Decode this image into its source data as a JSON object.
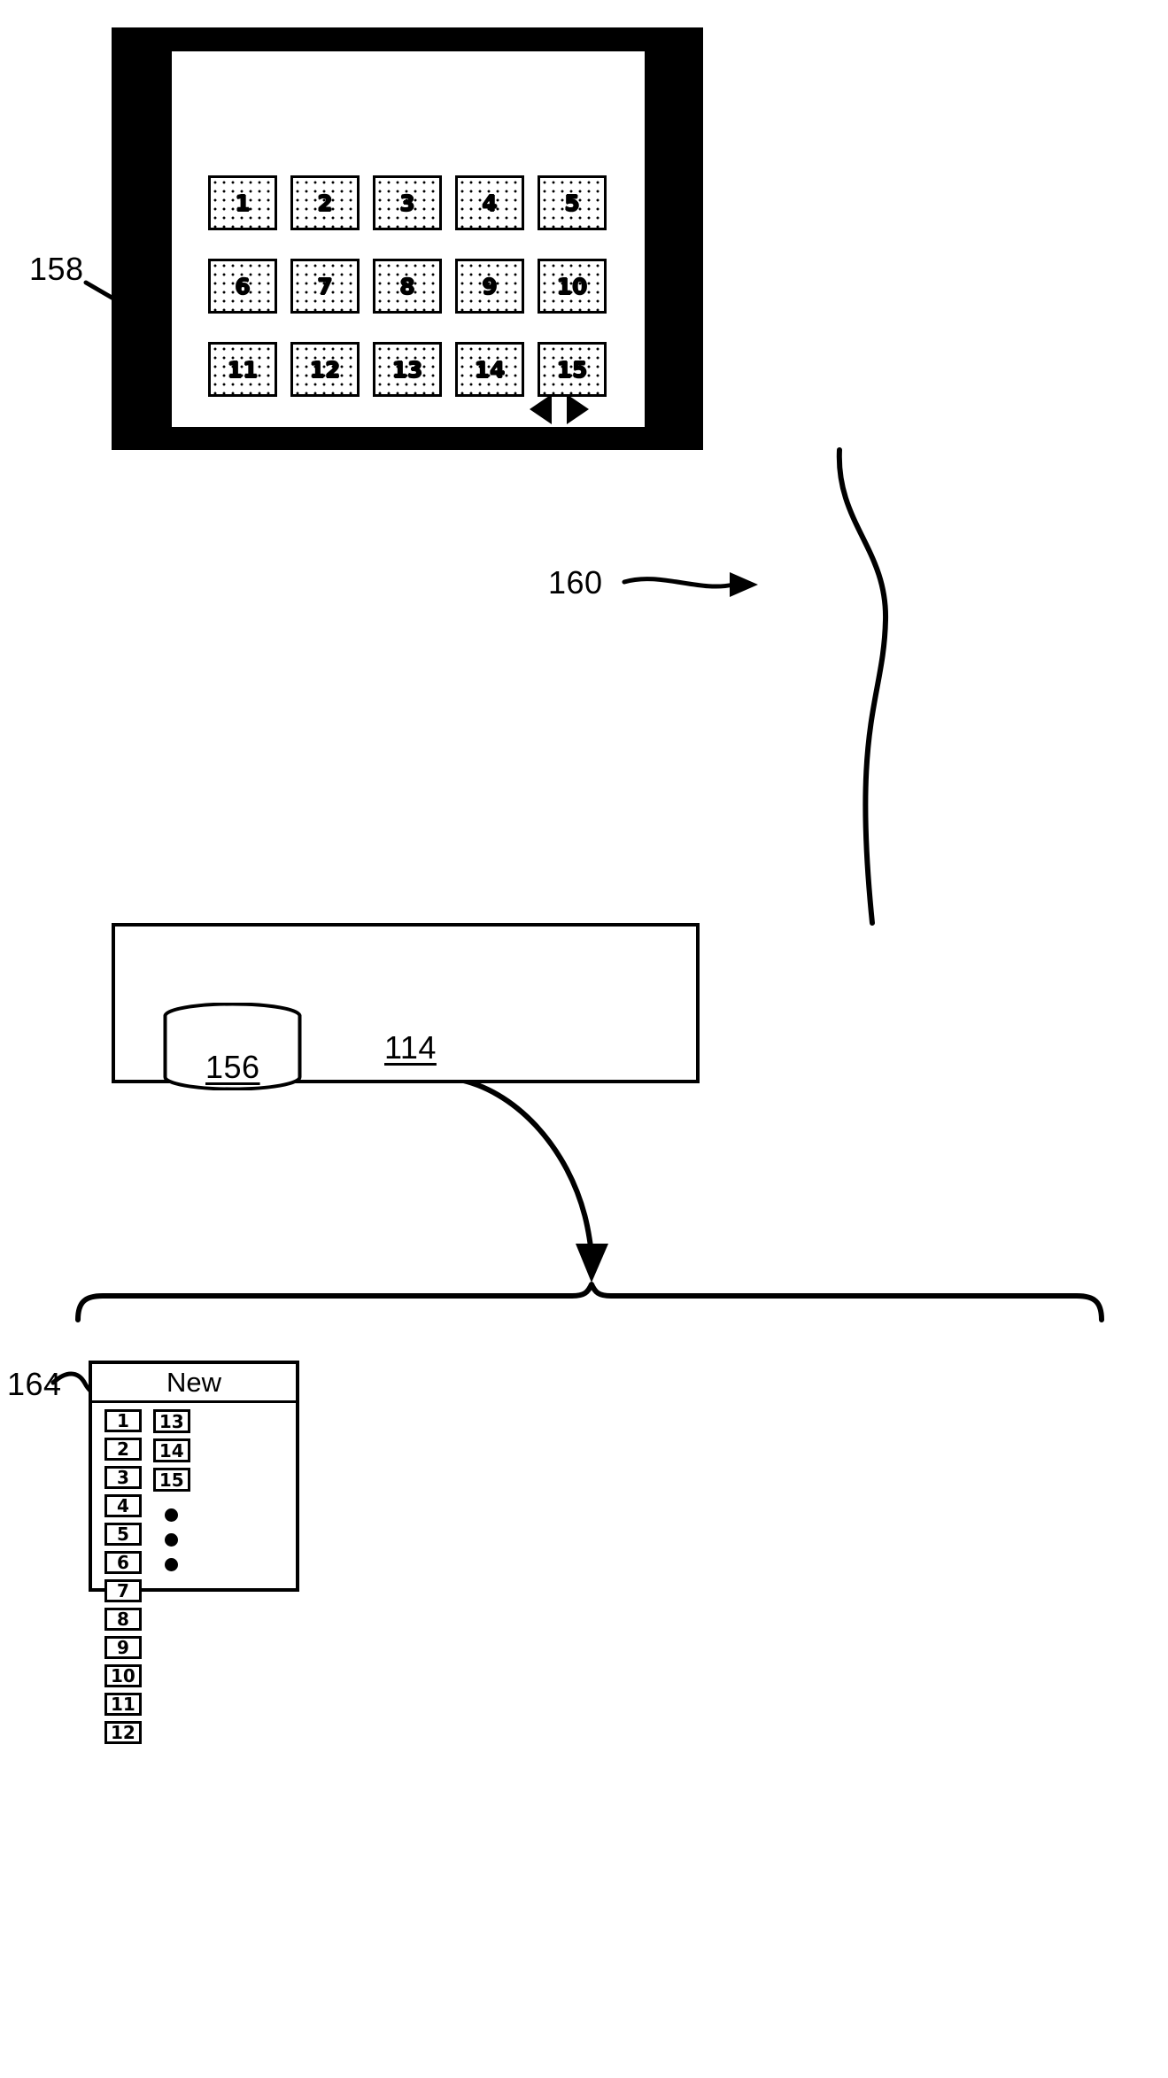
{
  "figure": {
    "type": "patent-diagram",
    "colors": {
      "ink": "#000000",
      "paper": "#ffffff"
    }
  },
  "display_device": {
    "ref_number": "158",
    "bezel_color": "#000000",
    "screen_color": "#ffffff",
    "tiles": [
      {
        "label": "1"
      },
      {
        "label": "2"
      },
      {
        "label": "3"
      },
      {
        "label": "4"
      },
      {
        "label": "5"
      },
      {
        "label": "6"
      },
      {
        "label": "7"
      },
      {
        "label": "8"
      },
      {
        "label": "9"
      },
      {
        "label": "10"
      },
      {
        "label": "11"
      },
      {
        "label": "12"
      },
      {
        "label": "13"
      },
      {
        "label": "14"
      },
      {
        "label": "15"
      }
    ],
    "navigation": {
      "ref_number": "160",
      "previous_icon": "triangle-left-icon",
      "next_icon": "triangle-right-icon"
    }
  },
  "server": {
    "ref_number": "114",
    "database": {
      "ref_number": "156",
      "icon": "database-cylinder-icon"
    }
  },
  "list_panel": {
    "ref_number": "164",
    "title": "New",
    "column_left": [
      "1",
      "2",
      "3",
      "4",
      "5",
      "6",
      "7",
      "8",
      "9",
      "10",
      "11",
      "12"
    ],
    "column_right": [
      "13",
      "14",
      "15"
    ],
    "overflow_indicator": "vertical-ellipsis"
  }
}
